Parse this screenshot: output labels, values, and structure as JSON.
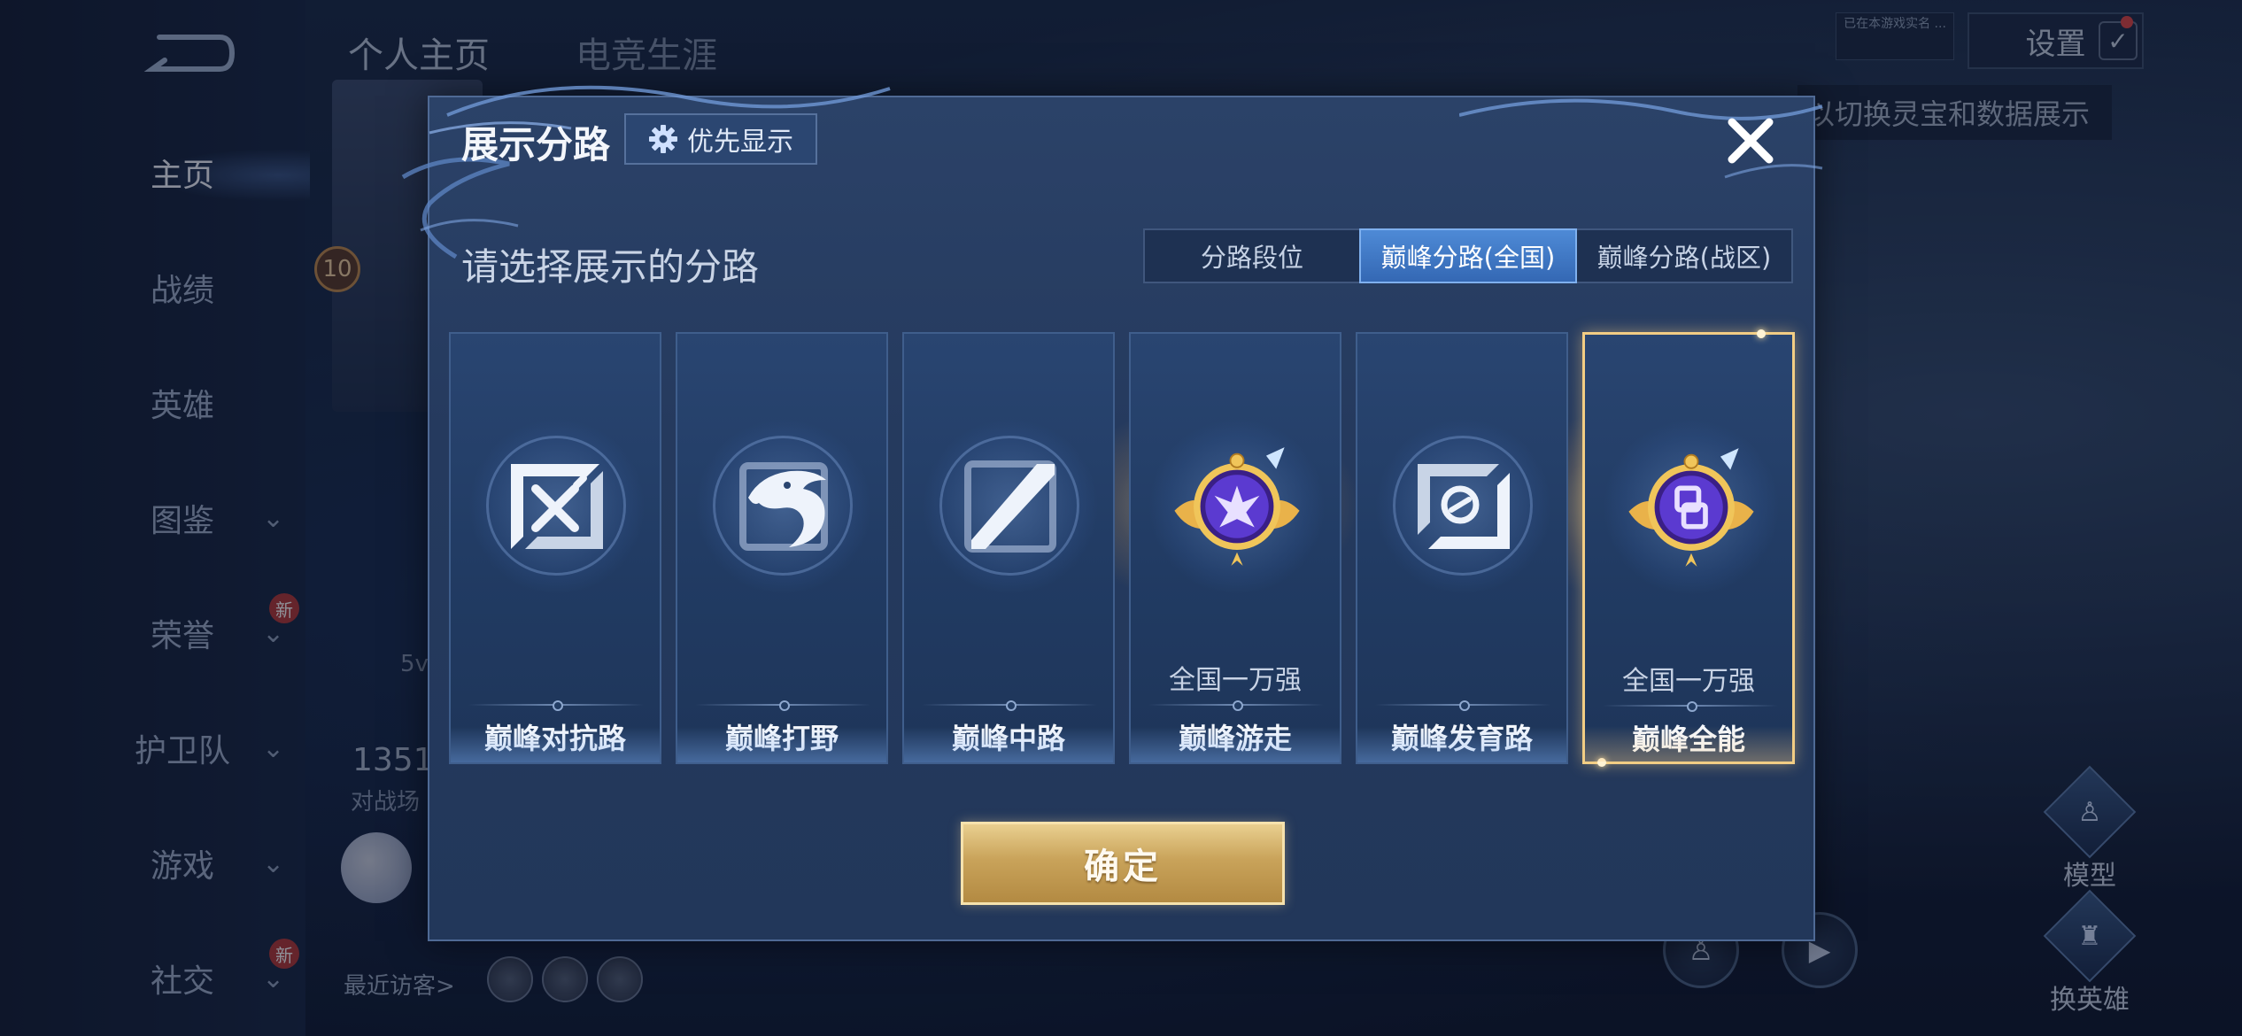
{
  "sidebar": {
    "items": [
      {
        "label": "主页",
        "has_chevron": false,
        "badge": ""
      },
      {
        "label": "战绩",
        "has_chevron": false,
        "badge": ""
      },
      {
        "label": "英雄",
        "has_chevron": false,
        "badge": ""
      },
      {
        "label": "图鉴",
        "has_chevron": true,
        "badge": ""
      },
      {
        "label": "荣誉",
        "has_chevron": true,
        "badge": "新"
      },
      {
        "label": "护卫队",
        "has_chevron": true,
        "badge": ""
      },
      {
        "label": "游戏",
        "has_chevron": true,
        "badge": ""
      },
      {
        "label": "社交",
        "has_chevron": true,
        "badge": "新"
      }
    ]
  },
  "header": {
    "tabs": [
      "个人主页",
      "电竞生涯"
    ],
    "settings_label": "设置",
    "small_tag": "已在本游戏实名 ...",
    "hint": "以切换灵宝和数据展示"
  },
  "profile": {
    "level": "10",
    "mode_text": "5v",
    "stat_number": "1351",
    "stat_label": "对战场",
    "visitors_label": "最近访客>"
  },
  "side_actions": [
    {
      "label": "模型",
      "icon": "figure-icon"
    },
    {
      "label": "换英雄",
      "icon": "swap-hero-icon"
    }
  ],
  "modal": {
    "title": "展示分路",
    "priority_label": "优先显示",
    "subtitle": "请选择展示的分路",
    "segment_tabs": [
      "分路段位",
      "巅峰分路(全国)",
      "巅峰分路(战区)"
    ],
    "active_tab_index": 1,
    "cards": [
      {
        "name": "巅峰对抗路",
        "rank": "",
        "emblem": "clash-lane-icon",
        "selected": false
      },
      {
        "name": "巅峰打野",
        "rank": "",
        "emblem": "jungle-icon",
        "selected": false
      },
      {
        "name": "巅峰中路",
        "rank": "",
        "emblem": "mid-lane-icon",
        "selected": false
      },
      {
        "name": "巅峰游走",
        "rank": "全国一万强",
        "emblem": "roam-medal-icon",
        "selected": false
      },
      {
        "name": "巅峰发育路",
        "rank": "",
        "emblem": "farm-lane-icon",
        "selected": false
      },
      {
        "name": "巅峰全能",
        "rank": "全国一万强",
        "emblem": "all-round-medal-icon",
        "selected": true
      }
    ],
    "confirm_label": "确定"
  },
  "colors": {
    "accent_blue": "#3468b4",
    "gold": "#f2cd84",
    "modal_bg": "#253a5e"
  }
}
